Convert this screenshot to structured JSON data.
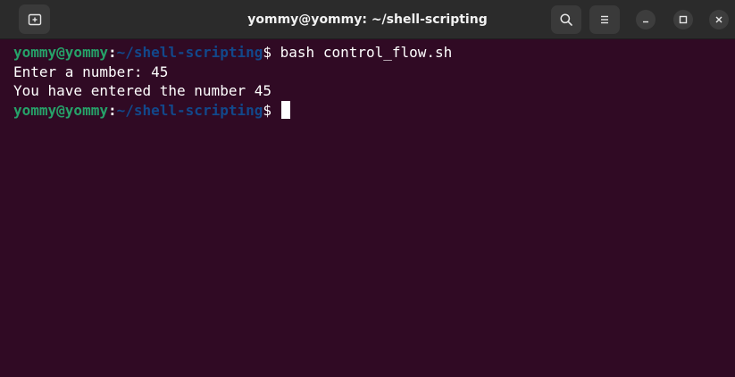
{
  "window": {
    "title": "yommy@yommy: ~/shell-scripting"
  },
  "icons": {
    "new_tab": "new-tab-icon",
    "search": "search-icon",
    "menu": "hamburger-menu-icon",
    "minimize": "minimize-icon",
    "maximize": "maximize-icon",
    "close": "close-icon"
  },
  "colors": {
    "background": "#300a24",
    "prompt_user": "#26a269",
    "prompt_path": "#12488b",
    "text": "#ffffff"
  },
  "terminal": {
    "prompt_user": "yommy@yommy",
    "prompt_colon": ":",
    "prompt_path": "~/shell-scripting",
    "prompt_symbol": "$",
    "command": " bash control_flow.sh",
    "output": [
      "Enter a number: 45",
      "You have entered the number 45"
    ]
  }
}
